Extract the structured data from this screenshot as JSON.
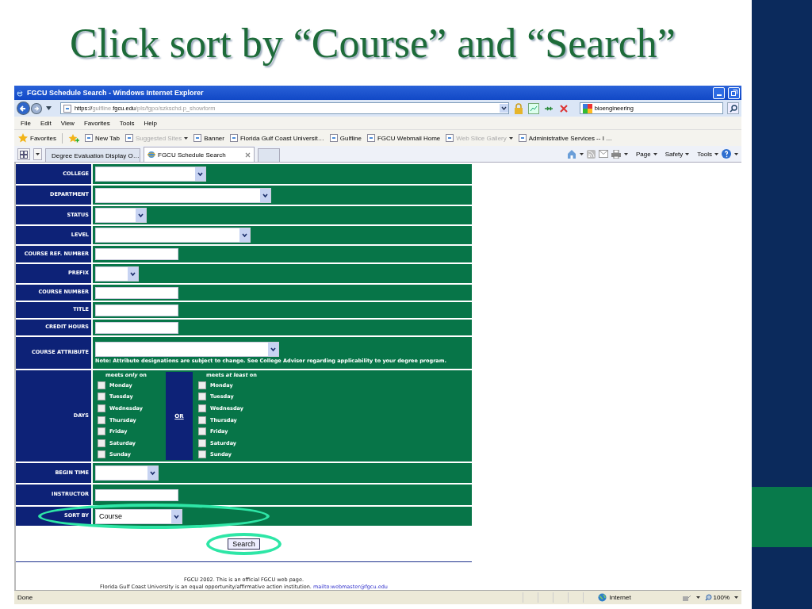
{
  "slide": {
    "title": "Click sort by “Course” and “Search”"
  },
  "browser": {
    "window_title": "FGCU Schedule Search - Windows Internet Explorer",
    "url": [
      {
        "text": "https://",
        "dim": false
      },
      {
        "text": "gulfline.",
        "dim": true
      },
      {
        "text": "fgcu.edu",
        "dim": false
      },
      {
        "text": "/pls/fgpo/szkschd.p_showform",
        "dim": true
      }
    ],
    "search_value": "bioengineering",
    "menu": [
      "File",
      "Edit",
      "View",
      "Favorites",
      "Tools",
      "Help"
    ],
    "favorites_label": "Favorites",
    "favorites": [
      {
        "label": "New Tab",
        "disabled": false,
        "dropdown": false
      },
      {
        "label": "Suggested Sites",
        "disabled": true,
        "dropdown": true
      },
      {
        "label": "Banner",
        "disabled": false,
        "dropdown": false
      },
      {
        "label": "Florida Gulf Coast Universit…",
        "disabled": false,
        "dropdown": false
      },
      {
        "label": "Gulfline",
        "disabled": false,
        "dropdown": false
      },
      {
        "label": "FGCU Webmail Home",
        "disabled": false,
        "dropdown": false
      },
      {
        "label": "Web Slice Gallery",
        "disabled": true,
        "dropdown": true
      },
      {
        "label": "Administrative Services -- I …",
        "disabled": false,
        "dropdown": false
      }
    ],
    "tabs": [
      {
        "label": "Degree Evaluation Display O…",
        "selected": false
      },
      {
        "label": "FGCU Schedule Search",
        "selected": true
      }
    ],
    "commands": [
      "Page",
      "Safety",
      "Tools"
    ],
    "status": {
      "text": "Done",
      "zone": "Internet",
      "zoom": "100%"
    }
  },
  "form": {
    "rows": [
      {
        "label": "COLLEGE",
        "kind": "select",
        "value": "",
        "highlighted": false
      },
      {
        "label": "DEPARTMENT",
        "kind": "select",
        "value": "",
        "highlighted": false
      },
      {
        "label": "STATUS",
        "kind": "select",
        "value": "",
        "highlighted": false
      },
      {
        "label": "LEVEL",
        "kind": "select",
        "value": "",
        "highlighted": false
      },
      {
        "label": "COURSE REF. NUMBER",
        "kind": "input",
        "value": "",
        "highlighted": false
      },
      {
        "label": "PREFIX",
        "kind": "select",
        "value": "",
        "highlighted": false
      },
      {
        "label": "COURSE NUMBER",
        "kind": "input",
        "value": "",
        "highlighted": false
      },
      {
        "label": "TITLE",
        "kind": "input",
        "value": "",
        "highlighted": false
      },
      {
        "label": "CREDIT HOURS",
        "kind": "input",
        "value": "",
        "highlighted": false
      },
      {
        "label": "COURSE ATTRIBUTE",
        "kind": "select",
        "value": "",
        "note": "Note: Attribute designations are subject to change. See College Advisor regarding applicability to your degree program.",
        "highlighted": false
      },
      {
        "label": "DAYS",
        "kind": "days",
        "highlighted": false
      },
      {
        "label": "BEGIN TIME",
        "kind": "select",
        "value": "",
        "highlighted": false
      },
      {
        "label": "INSTRUCTOR",
        "kind": "input",
        "value": "",
        "highlighted": false
      },
      {
        "label": "SORT BY",
        "kind": "select",
        "value": "Course",
        "highlighted": true
      }
    ],
    "days": {
      "only_heading": "meets *only* on",
      "or_label": "OR",
      "least_heading": "meets *at least* on",
      "only": [
        {
          "label": "Monday",
          "checked": false
        },
        {
          "label": "Tuesday",
          "checked": false
        },
        {
          "label": "Wednesday",
          "checked": false
        },
        {
          "label": "Thursday",
          "checked": false
        },
        {
          "label": "Friday",
          "checked": false
        },
        {
          "label": "Saturday",
          "checked": false
        },
        {
          "label": "Sunday",
          "checked": false
        }
      ],
      "least": [
        {
          "label": "Monday",
          "checked": false
        },
        {
          "label": "Tuesday",
          "checked": false
        },
        {
          "label": "Wednesday",
          "checked": false
        },
        {
          "label": "Thursday",
          "checked": false
        },
        {
          "label": "Friday",
          "checked": false
        },
        {
          "label": "Saturday",
          "checked": false
        },
        {
          "label": "Sunday",
          "checked": false
        }
      ]
    },
    "search_button": {
      "label": "Search",
      "highlighted": true
    },
    "footer": [
      "FGCU 2002. This is an official FGCU web page."
    ],
    "footer_line2": {
      "text": "Florida Gulf Coast University is an equal opportunity/affirmative action institution.",
      "link": "mailto:webmaster@fgcu.edu"
    }
  }
}
